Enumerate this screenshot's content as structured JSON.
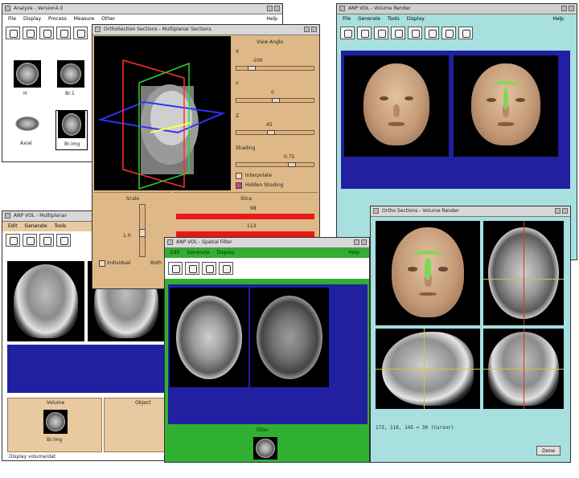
{
  "analyze_window": {
    "title": "Analyze - Version4.0",
    "menu": [
      "File",
      "Display",
      "Process",
      "Measure",
      "Other",
      "Help"
    ],
    "thumbnails": [
      "H",
      "Br.1",
      "Axial",
      "Br.img"
    ]
  },
  "oblique_window": {
    "title": "OrthoSection Sections - Multiplanar Sections",
    "view_angle_label": "View Angle",
    "x_label": "X",
    "x_value": "-100",
    "y_label": "Y",
    "y_value": "0",
    "z_label": "Z",
    "z_value": "45",
    "shading_label": "Shading",
    "shading_value": "0.75",
    "interpolate_label": "Interpolate",
    "hidden_shading_label": "Hidden Shading",
    "scale_label": "Scale",
    "scale_value": "1.0",
    "slice_label": "Slice",
    "slice_top_value": "98",
    "slice_bottom_value": "113",
    "individual_label": "Individual",
    "both_label": "Both"
  },
  "volume_render_window": {
    "title": "ANP VOL - Volume Render",
    "menu": [
      "File",
      "Generate",
      "Tools",
      "Display"
    ],
    "help": "Help"
  },
  "multiplanar_window": {
    "title": "ANP VOL - Multiplanar",
    "menu": [
      "Edit",
      "Generate",
      "Tools"
    ],
    "volume_label": "Volume",
    "object_label": "Object",
    "thumb_label": "Br.img",
    "status": "Display volume/dat"
  },
  "spatial_window": {
    "title": "ANP VOL - Spatial Filter",
    "menu": [
      "Edit",
      "Generate",
      "Display"
    ],
    "help": "Help",
    "bottom_label": "Filter"
  },
  "ortho_render_window": {
    "title": "Ortho Sections - Volume Render",
    "coords": "173, 116, 145 = 39 (Cursor)",
    "done": "Done"
  }
}
